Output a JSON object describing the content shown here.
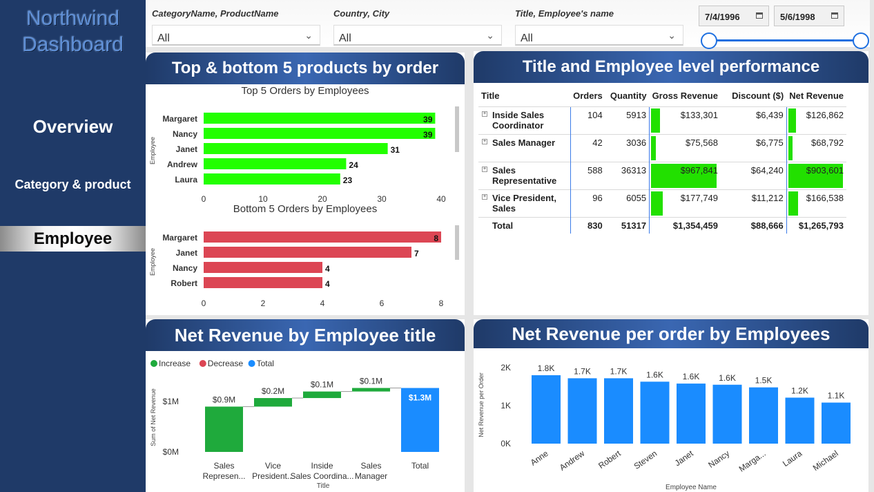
{
  "sidebar": {
    "title_line1": "Northwind",
    "title_line2": "Dashboard",
    "nav": [
      "Overview",
      "Category & product",
      "Employee"
    ]
  },
  "filters": {
    "slicers": [
      {
        "title": "CategoryName, ProductName",
        "value": "All"
      },
      {
        "title": "Country, City",
        "value": "All"
      },
      {
        "title": "Title, Employee's name",
        "value": "All"
      }
    ],
    "date_start": "7/4/1996",
    "date_end": "5/6/1998"
  },
  "panel_products": {
    "title": "Top & bottom 5 products by order"
  },
  "panel_table": {
    "title": "Title and Employee level performance",
    "columns": [
      "Title",
      "Orders",
      "Quantity",
      "Gross Revenue",
      "Discount ($)",
      "Net Revenue"
    ],
    "rows": [
      {
        "title": "Inside Sales Coordinator",
        "orders": "104",
        "quantity": "5913",
        "gross": "$133,301",
        "discount": "$6,439",
        "net": "$126,862",
        "gross_frac": 0.138,
        "net_frac": 0.14
      },
      {
        "title": "Sales Manager",
        "orders": "42",
        "quantity": "3036",
        "gross": "$75,568",
        "discount": "$6,775",
        "net": "$68,792",
        "gross_frac": 0.078,
        "net_frac": 0.076
      },
      {
        "title": "Sales Representative",
        "orders": "588",
        "quantity": "36313",
        "gross": "$967,841",
        "discount": "$64,240",
        "net": "$903,601",
        "gross_frac": 1.0,
        "net_frac": 1.0
      },
      {
        "title": "Vice President, Sales",
        "orders": "96",
        "quantity": "6055",
        "gross": "$177,749",
        "discount": "$11,212",
        "net": "$166,538",
        "gross_frac": 0.184,
        "net_frac": 0.184
      }
    ],
    "total": {
      "label": "Total",
      "orders": "830",
      "quantity": "51317",
      "gross": "$1,354,459",
      "discount": "$88,666",
      "net": "$1,265,793"
    }
  },
  "panel_waterfall": {
    "title": "Net Revenue by Employee title"
  },
  "panel_perorder": {
    "title": "Net Revenue per order by Employees"
  },
  "chart_data": [
    {
      "type": "bar",
      "orientation": "horizontal",
      "title": "Top 5 Orders by Employees",
      "ylabel": "Employee",
      "categories": [
        "Margaret",
        "Nancy",
        "Janet",
        "Andrew",
        "Laura"
      ],
      "values": [
        39,
        39,
        31,
        24,
        23
      ],
      "xlim": [
        0,
        40
      ],
      "xticks": [
        "0",
        "10",
        "20",
        "30",
        "40"
      ],
      "color": "#22ff00"
    },
    {
      "type": "bar",
      "orientation": "horizontal",
      "title": "Bottom 5 Orders by Employees",
      "ylabel": "Employee",
      "categories": [
        "Margaret",
        "Janet",
        "Nancy",
        "Robert"
      ],
      "values": [
        8,
        7,
        4,
        4
      ],
      "xlim": [
        0,
        8
      ],
      "xticks": [
        "0",
        "2",
        "4",
        "6",
        "8"
      ],
      "color": "#dc4654"
    },
    {
      "type": "bar",
      "subtype": "waterfall",
      "legend": [
        {
          "name": "Increase",
          "color": "#1faa3c"
        },
        {
          "name": "Decrease",
          "color": "#dc4654"
        },
        {
          "name": "Total",
          "color": "#1a8cff"
        }
      ],
      "ylabel": "Sum of Net Revenue",
      "xlabel": "Title",
      "yticks": [
        "$0M",
        "$1M"
      ],
      "ylim": [
        0,
        1.4
      ],
      "categories": [
        "Sales Represen...",
        "Vice President...",
        "Inside Sales Coordina...",
        "Sales Manager",
        "Total"
      ],
      "values": [
        0.9,
        0.17,
        0.13,
        0.07,
        1.27
      ],
      "labels": [
        "$0.9M",
        "$0.2M",
        "$0.1M",
        "$0.1M",
        "$1.3M"
      ],
      "kinds": [
        "increase",
        "increase",
        "increase",
        "increase",
        "total"
      ]
    },
    {
      "type": "bar",
      "ylabel": "Net Revenue per Order",
      "xlabel": "Employee Name",
      "categories": [
        "Anne",
        "Andrew",
        "Robert",
        "Steven",
        "Janet",
        "Nancy",
        "Marga...",
        "Laura",
        "Michael"
      ],
      "values": [
        1.8,
        1.72,
        1.72,
        1.63,
        1.58,
        1.55,
        1.48,
        1.21,
        1.08
      ],
      "labels": [
        "1.8K",
        "1.7K",
        "1.7K",
        "1.6K",
        "1.6K",
        "1.6K",
        "1.5K",
        "1.2K",
        "1.1K"
      ],
      "yticks": [
        "0K",
        "1K",
        "2K"
      ],
      "ylim": [
        0,
        2
      ],
      "color": "#1a8cff"
    }
  ]
}
